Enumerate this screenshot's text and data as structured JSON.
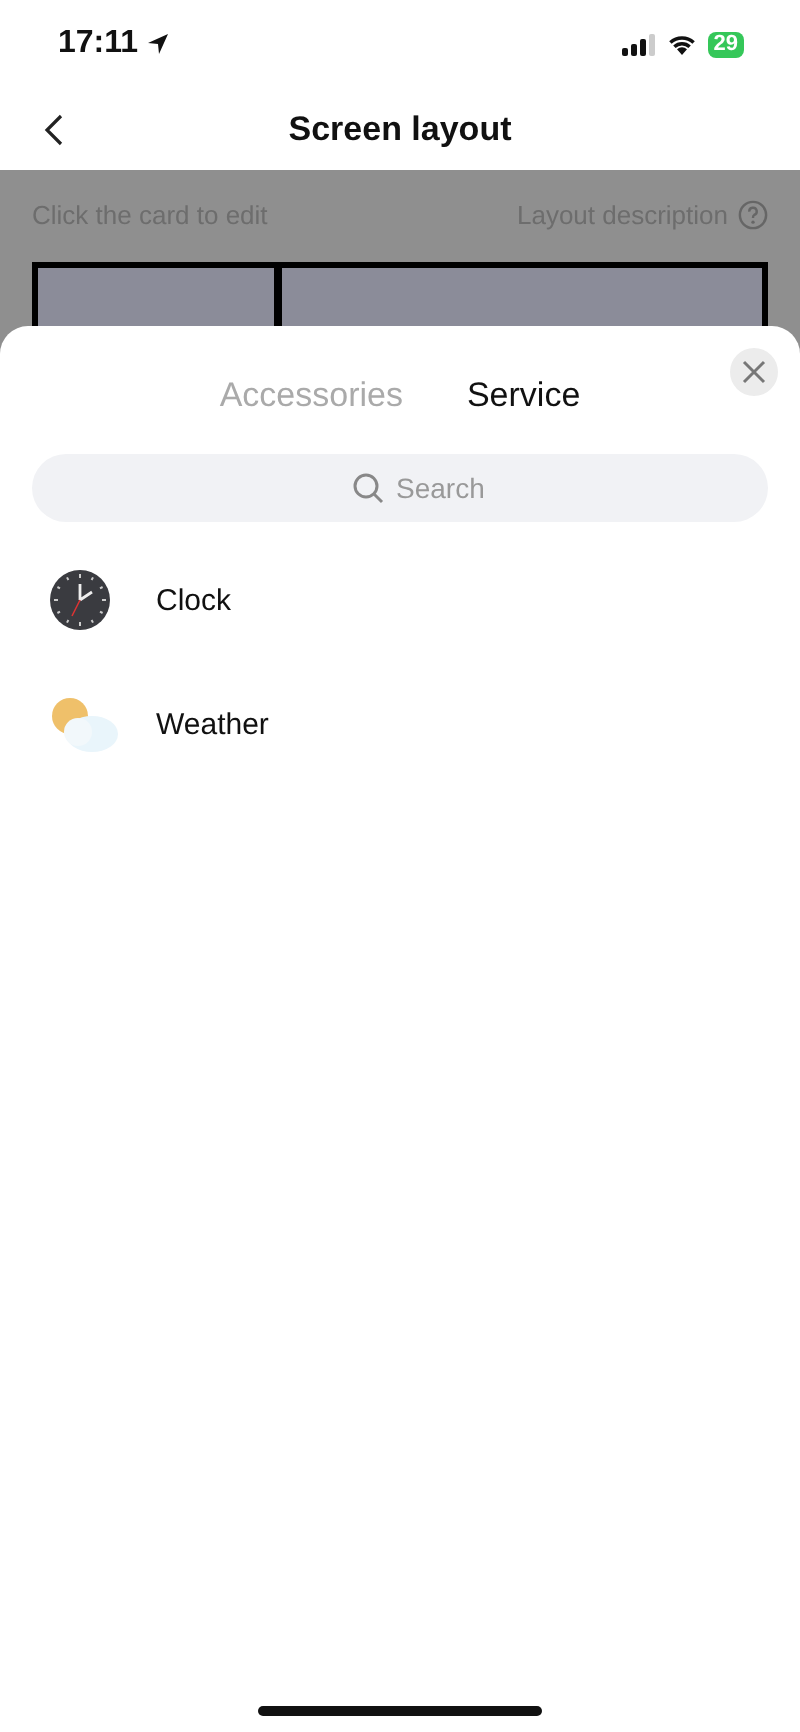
{
  "status_bar": {
    "time": "17:11",
    "battery": "29"
  },
  "nav": {
    "title": "Screen layout"
  },
  "page": {
    "hint": "Click the card to edit",
    "help": "Layout description"
  },
  "sheet": {
    "tabs": [
      {
        "label": "Accessories",
        "selected": false
      },
      {
        "label": "Service",
        "selected": true
      }
    ],
    "search": {
      "placeholder": "Search"
    },
    "items": [
      {
        "kind": "clock",
        "label": "Clock"
      },
      {
        "kind": "weather",
        "label": "Weather"
      }
    ]
  }
}
